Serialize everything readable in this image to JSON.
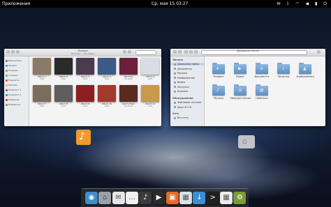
{
  "panel": {
    "apps_label": "Приложения",
    "clock": "Ср, мая 15 03:27"
  },
  "music_window": {
    "title": "Музыка",
    "subtitle": "Hot Fuss — The Killers",
    "sidebar_items": [
      "Библиотека",
      "Музыка",
      "Очередь",
      "Станции",
      "Подкасты",
      "Магазин",
      "Плейлист 1",
      "Плейлист 2",
      "Недавние",
      "Избранное"
    ],
    "albums": [
      {
        "title": "Album 1",
        "artist": "Artist",
        "color": "#8a7a66"
      },
      {
        "title": "Album 2",
        "artist": "Artist",
        "color": "#2a2a2a"
      },
      {
        "title": "Album 3",
        "artist": "Artist",
        "color": "#4b3b4f"
      },
      {
        "title": "Album 4",
        "artist": "Artist",
        "color": "#3b5a86"
      },
      {
        "title": "Hot Fuss",
        "artist": "The Killers",
        "color": "#6b1f3a"
      },
      {
        "title": "Album 6",
        "artist": "Artist",
        "color": "#d8dde4"
      },
      {
        "title": "Album 7",
        "artist": "Artist",
        "color": "#7a6d5c"
      },
      {
        "title": "Album 8",
        "artist": "Artist",
        "color": "#5e5e5e"
      },
      {
        "title": "Album 9",
        "artist": "Artist",
        "color": "#8c1f22"
      },
      {
        "title": "Album 10",
        "artist": "Artist",
        "color": "#a23a2c"
      },
      {
        "title": "Sam's Town",
        "artist": "The Killers",
        "color": "#5b2a1f"
      },
      {
        "title": "Album 12",
        "artist": "Artist",
        "color": "#c89a4a"
      }
    ]
  },
  "files_window": {
    "title": "Домашняя папка",
    "sidebar": {
      "personal_header": "Личное",
      "personal_items": [
        "Домашняя папка",
        "Документы",
        "Музыка",
        "Изображения",
        "Видео",
        "Загрузки",
        "Корзина"
      ],
      "devices_header": "Оборудование",
      "device_items": [
        "Файловая система",
        "Диск 40 ГБ"
      ],
      "network_header": "Сеть",
      "network_items": [
        "Вся сеть"
      ]
    },
    "folders": [
      {
        "label": "Dropbox",
        "glyph": "▾"
      },
      {
        "label": "Видео",
        "glyph": "▶"
      },
      {
        "label": "Документы",
        "glyph": "≡"
      },
      {
        "label": "Загрузки",
        "glyph": "↓"
      },
      {
        "label": "Изображения",
        "glyph": "▲"
      },
      {
        "label": "Музыка",
        "glyph": "♪"
      },
      {
        "label": "Общедоступные",
        "glyph": "◎"
      },
      {
        "label": "Шаблоны",
        "glyph": "▤"
      }
    ]
  },
  "dock": {
    "apps": [
      {
        "name": "midori-browser-icon",
        "color": "#3e8ec9",
        "glyph": "◉"
      },
      {
        "name": "files-home-icon",
        "color": "#9aa1a8",
        "glyph": "⌂"
      },
      {
        "name": "mail-icon",
        "color": "#e6e6e6",
        "glyph": "✉"
      },
      {
        "name": "chat-icon",
        "color": "#f0f0f0",
        "glyph": "…"
      },
      {
        "name": "music-player-icon",
        "color": "#3b3b3b",
        "glyph": "♪"
      },
      {
        "name": "video-player-icon",
        "color": "#2b2b2b",
        "glyph": "▶"
      },
      {
        "name": "photos-icon",
        "color": "#e56b2b",
        "glyph": "▣"
      },
      {
        "name": "shotwell-icon",
        "color": "#d9e2ea",
        "glyph": "▦"
      },
      {
        "name": "software-center-icon",
        "color": "#3c8fd4",
        "glyph": "↓"
      },
      {
        "name": "terminal-icon",
        "color": "#202020",
        "glyph": ">"
      },
      {
        "name": "calendar-icon",
        "color": "#ececec",
        "glyph": "▦"
      },
      {
        "name": "system-settings-icon",
        "color": "#7a9b3a",
        "glyph": "⚙"
      }
    ]
  }
}
